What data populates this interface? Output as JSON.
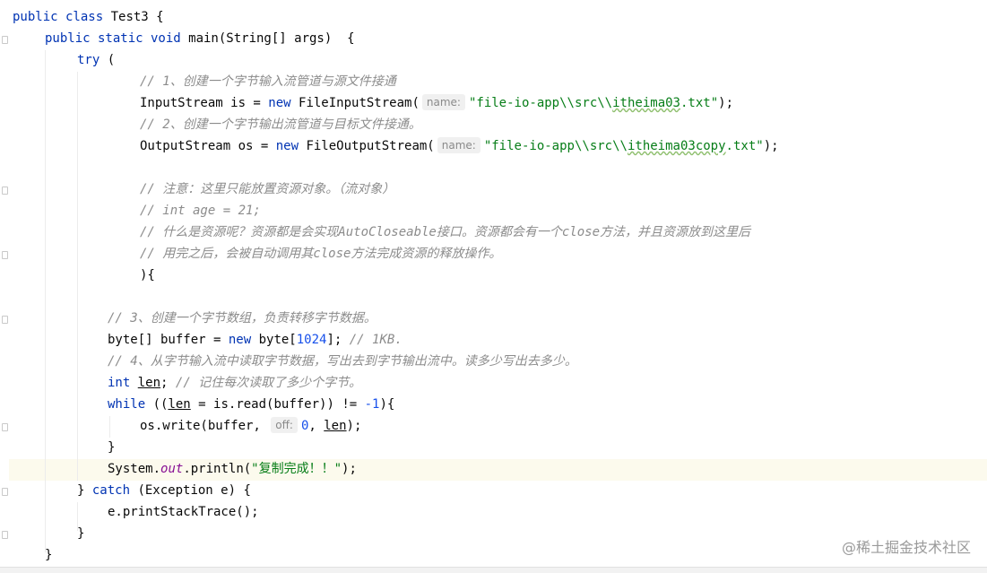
{
  "code": {
    "class_decl": {
      "kw": "public class",
      "name": " Test3 {"
    },
    "main_decl": {
      "kw1": "public static void",
      "rest": " main(String[] args)  {"
    },
    "try_open": {
      "kw": "try",
      "rest": " ("
    },
    "c1": "// 1、创建一个字节输入流管道与源文件接通",
    "is_decl": {
      "type": "InputStream is = ",
      "kw": "new",
      "cls": " FileInputStream(",
      "hint": "name:",
      "str_a": "\"file-io-app\\\\src\\\\",
      "str_b": "itheima03",
      "str_c": ".txt\"",
      "end": ");"
    },
    "c2": "// 2、创建一个字节输出流管道与目标文件接通。",
    "os_decl": {
      "type": "OutputStream os = ",
      "kw": "new",
      "cls": " FileOutputStream(",
      "hint": "name:",
      "str_a": "\"file-io-app\\\\src\\\\",
      "str_b": "itheima03copy",
      "str_c": ".txt\"",
      "end": ");"
    },
    "c3": "// 注意：这里只能放置资源对象。（流对象）",
    "c4": "// int age = 21;",
    "c5": "// 什么是资源呢？资源都是会实现AutoCloseable接口。资源都会有一个close方法，并且资源放到这里后",
    "c6": "// 用完之后，会被自动调用其close方法完成资源的释放操作。",
    "paren_close": "){",
    "c7": "// 3、创建一个字节数组，负责转移字节数据。",
    "buffer_decl": {
      "a": "byte[] buffer = ",
      "kw": "new",
      "b": " byte[",
      "num": "1024",
      "c": "]; ",
      "cmt": "// 1KB."
    },
    "c8": "// 4、从字节输入流中读取字节数据，写出去到字节输出流中。读多少写出去多少。",
    "len_decl": {
      "kw": "int",
      "sp": " ",
      "var": "len",
      "semi": "; ",
      "cmt": "// 记住每次读取了多少个字节。"
    },
    "while_line": {
      "kw": "while",
      "a": " ((",
      "var": "len",
      "b": " = is.read(buffer)) != ",
      "num": "-1",
      "c": "){"
    },
    "write_line": {
      "a": "os.write(buffer, ",
      "hint": "off:",
      "num": "0",
      "b": ", ",
      "var": "len",
      "c": ");"
    },
    "close_brace_inner": "}",
    "println_line": {
      "a": "System.",
      "fld": "out",
      "b": ".println(",
      "str": "\"复制完成！！\"",
      "c": ");"
    },
    "catch_line": {
      "a": "} ",
      "kw": "catch",
      "b": " (Exception e) {"
    },
    "trace_line": "e.printStackTrace();",
    "close_brace_try": "}",
    "close_brace_main": "}"
  },
  "watermark": "@稀土掘金技术社区"
}
